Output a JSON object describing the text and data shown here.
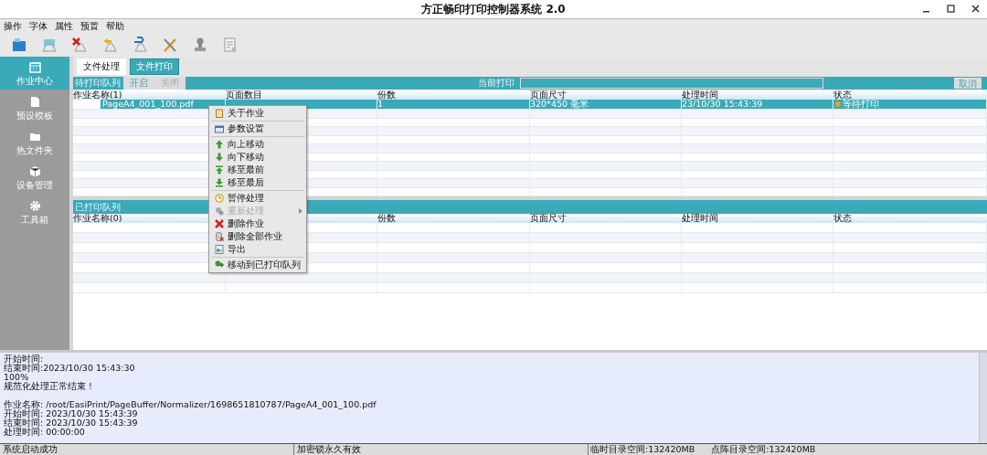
{
  "window": {
    "title": "方正畅印打印控制器系统 2.0"
  },
  "menu": [
    "操作",
    "字体",
    "属性",
    "预置",
    "帮助"
  ],
  "sidebar": {
    "items": [
      {
        "label": "作业中心",
        "selected": true
      },
      {
        "label": "预设模板",
        "selected": false
      },
      {
        "label": "热文件夹",
        "selected": false
      },
      {
        "label": "设备管理",
        "selected": false
      },
      {
        "label": "工具箱",
        "selected": false
      }
    ]
  },
  "tabs": [
    {
      "label": "文件处理",
      "selected": true
    },
    {
      "label": "文件打印",
      "selected": false
    }
  ],
  "pending_queue": {
    "title": "待打印队列",
    "buttons": [
      {
        "label": "开启",
        "disabled": false
      },
      {
        "label": "关闭",
        "disabled": true
      }
    ],
    "current_label": "当前打印",
    "cancel": "取消",
    "columns": {
      "name": "作业名称(1)",
      "pages": "页面数目",
      "copies": "份数",
      "size": "页面尺寸",
      "time": "处理时间",
      "status": "状态"
    },
    "rows": [
      {
        "name": "PageA4_001_100.pdf",
        "copies": "1",
        "size": "320*450 毫米",
        "time": "23/10/30 15:43:39",
        "status": "等待打印",
        "color": "#f0a020",
        "selected": true
      }
    ]
  },
  "printed_queue": {
    "title": "已打印队列",
    "columns": {
      "name": "作业名称(0)",
      "copies": "份数",
      "size": "页面尺寸",
      "time": "处理时间",
      "status": "状态"
    }
  },
  "context_menu": {
    "groups": [
      [
        {
          "label": "关于作业",
          "disabled": false,
          "submenu": false
        }
      ],
      [
        {
          "label": "参数设置",
          "disabled": false,
          "submenu": false
        }
      ],
      [
        {
          "label": "向上移动",
          "disabled": false,
          "submenu": false
        },
        {
          "label": "向下移动",
          "disabled": false,
          "submenu": false
        },
        {
          "label": "移至最前",
          "disabled": false,
          "submenu": false
        },
        {
          "label": "移至最后",
          "disabled": false,
          "submenu": false
        }
      ],
      [
        {
          "label": "暂停处理",
          "disabled": false,
          "submenu": false
        },
        {
          "label": "重新处理",
          "disabled": true,
          "submenu": true
        },
        {
          "label": "删除作业",
          "disabled": false,
          "submenu": false
        },
        {
          "label": "删除全部作业",
          "disabled": false,
          "submenu": false
        },
        {
          "label": "导出",
          "disabled": false,
          "submenu": false
        }
      ],
      [
        {
          "label": "移动到已打印队列",
          "disabled": false,
          "submenu": false
        }
      ]
    ]
  },
  "log": {
    "paragraphs": [
      [
        "开始时间:",
        "结束时间:2023/10/30 15:43:30",
        "100%",
        "规范化处理正常结束！"
      ],
      [
        "作业名称: /root/EasiPrint/PageBuffer/Normalizer/1698651810787/PageA4_001_100.pdf",
        "开始时间: 2023/10/30 15:43:39",
        "结束时间: 2023/10/30 15:43:39",
        "处理时间: 00:00:00"
      ]
    ]
  },
  "status_bar": [
    "系统启动成功",
    "加密锁永久有效",
    "临时目录空间:132420MB",
    "点阵目录空间:132420MB"
  ]
}
